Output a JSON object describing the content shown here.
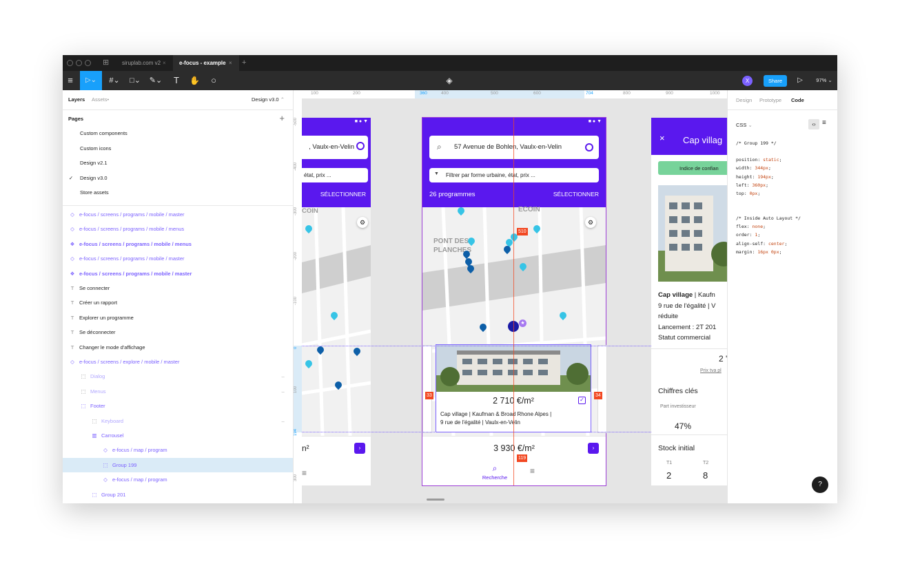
{
  "window": {
    "tabs": [
      {
        "label": "siruplab.com v2"
      },
      {
        "label": "e-focus - example"
      }
    ],
    "zoom": "97%",
    "share_label": "Share",
    "avatar_initial": "X"
  },
  "left_panel": {
    "tab_layers": "Layers",
    "tab_assets": "Assets",
    "page_selector": "Design v3.0",
    "pages_title": "Pages",
    "pages": [
      {
        "label": "Custom components"
      },
      {
        "label": "Custom icons"
      },
      {
        "label": "Design v2.1"
      },
      {
        "label": "Design v3.0",
        "check": "✓"
      },
      {
        "label": "Store assets"
      }
    ],
    "layers": [
      {
        "label": "e-focus / screens / programs / mobile / master",
        "icon": "◇"
      },
      {
        "label": "e-focus / screens / programs / mobile / menus",
        "icon": "◇"
      },
      {
        "label": "e-focus / screens / programs / mobile / menus",
        "icon": "❖"
      },
      {
        "label": "e-focus / screens / programs / mobile / master",
        "icon": "◇"
      },
      {
        "label": "e-focus / screens / programs / mobile / master",
        "icon": "❖"
      },
      {
        "label": "Se connecter",
        "icon": "T"
      },
      {
        "label": "Créer un rapport",
        "icon": "T"
      },
      {
        "label": "Explorer un programme",
        "icon": "T"
      },
      {
        "label": "Se déconnecter",
        "icon": "T"
      },
      {
        "label": "Changer le mode d'affichage",
        "icon": "T"
      },
      {
        "label": "e-focus / screens / explore / mobile / master",
        "icon": "◇"
      },
      {
        "label": "Dialog",
        "icon": "⬚"
      },
      {
        "label": "Menus",
        "icon": "⬚"
      },
      {
        "label": "Footer",
        "icon": "⬚"
      },
      {
        "label": "Keyboard",
        "icon": "⬚"
      },
      {
        "label": "Carrousel",
        "icon": "▥"
      },
      {
        "label": "e-focus / map / program",
        "icon": "◇"
      },
      {
        "label": "Group 199",
        "icon": "⬚"
      },
      {
        "label": "e-focus / map / program",
        "icon": "◇"
      },
      {
        "label": "Group 201",
        "icon": "⬚"
      }
    ]
  },
  "ruler": {
    "top": [
      "100",
      "200",
      "360",
      "400",
      "500",
      "600",
      "704",
      "800",
      "900",
      "1000"
    ],
    "left": [
      "-500",
      "-400",
      "-300",
      "-200",
      "-100",
      "0",
      "100",
      "194",
      "300"
    ]
  },
  "canvas": {
    "left_frame": {
      "search_text": ", Vaulx-en-Velin",
      "filter_text": "état, prix ...",
      "select_label": "SÉLECTIONNER",
      "map_label": "COIN",
      "price_text": "n²"
    },
    "center_frame": {
      "search_text": "57 Avenue de Bohlen, Vaulx-en-Velin",
      "filter_text": "Filtrer par forme urbaine, état, prix ...",
      "programs_count": "26 programmes",
      "select_label": "SÉLECTIONNER",
      "map_labels": [
        "PONT DES",
        "PLANCHES",
        "ECOIN"
      ],
      "measure_510": "510",
      "measure_33": "33",
      "measure_34": "34",
      "measure_119": "119",
      "card_price": "2 710 €/m²",
      "card_line1": "Cap village | Kaufman & Broad Rhone Alpes |",
      "card_line2": "9 rue de l'égalité | Vaulx-en-Velin",
      "bottom_price": "3 930 €/m²",
      "nav_search_label": "Recherche"
    },
    "right_frame": {
      "title": "Cap villag",
      "badge": "Indice de confian",
      "info_title": "Cap village",
      "info_title_rest": " | Kaufn",
      "info_line2": "9 rue de l'égalité | V",
      "info_line3": "réduite",
      "info_line4": "Lancement : 2T 201",
      "info_line5": "Statut commercial",
      "big_number": "2 '",
      "price_link": "Prix tva pl",
      "section_key_figures": "Chiffres clés",
      "investor_label": "Part investisseur",
      "investor_value": "47%",
      "section_stock": "Stock initial",
      "stock": [
        {
          "label": "T1",
          "value": "2"
        },
        {
          "label": "T2",
          "value": "8"
        }
      ]
    }
  },
  "right_panel": {
    "tab_design": "Design",
    "tab_prototype": "Prototype",
    "tab_code": "Code",
    "lang": "CSS",
    "comment_group": "/* Group 199 */",
    "props_group": [
      {
        "k": "position",
        "v": "static"
      },
      {
        "k": "width",
        "v": "344px"
      },
      {
        "k": "height",
        "v": "194px"
      },
      {
        "k": "left",
        "v": "360px"
      },
      {
        "k": "top",
        "v": "0px"
      }
    ],
    "comment_auto": "/* Inside Auto Layout */",
    "props_auto": [
      {
        "k": "flex",
        "v": "none"
      },
      {
        "k": "order",
        "v": "1"
      },
      {
        "k": "align-self",
        "v": "center"
      },
      {
        "k": "margin",
        "v": "16px 0px"
      }
    ],
    "help": "?"
  },
  "colors": {
    "figma_dark": "#2c2c2c",
    "figma_blue": "#18a0fb",
    "app_purple": "#5a18ee",
    "component_purple": "#7b61ff",
    "measure_red": "#f24822",
    "selection_blue": "#daebf7"
  }
}
